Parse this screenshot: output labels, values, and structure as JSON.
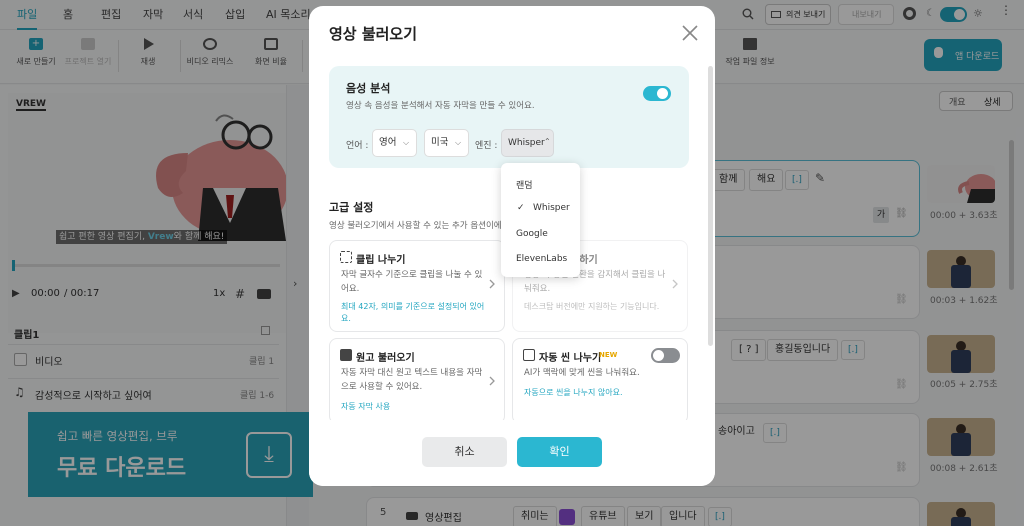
{
  "menu": {
    "tabs": [
      "파일",
      "홈",
      "편집",
      "자막",
      "서식",
      "삽입",
      "AI 목소리"
    ],
    "feedback": "의견 보내기",
    "export": "내보내기"
  },
  "toolbar": {
    "new": "새로 만들기",
    "open": "프로젝트 열기",
    "play": "재생",
    "remix": "비디오 리믹스",
    "ratio": "화면 비율",
    "info": "작업 파일 정보",
    "app_download": "앱 다운로드"
  },
  "player": {
    "caption_pre": "쉽고 편한 영상 편집기,",
    "caption_brand": "Vrew",
    "caption_post": "와 함께 해요!",
    "current": "00:00",
    "total": "/ 00:17",
    "speed": "1x"
  },
  "clip_panel": {
    "title": "클립1",
    "video_label": "비디오",
    "video_meta": "클립 1",
    "music_label": "감성적으로 시작하고 싶어여",
    "music_meta": "클립 1-6"
  },
  "banner": {
    "line1": "쉽고 빠른 영상편집, 브루",
    "line2": "무료 다운로드"
  },
  "view_toggle": {
    "summary": "개요",
    "detail": "상세"
  },
  "clips": [
    {
      "words": [
        "함께",
        "해요",
        "[.]"
      ],
      "thumb_cap": "00:00 + 3.63초",
      "action": "가"
    },
    {
      "words": [],
      "thumb_cap": "00:03 + 1.62초"
    },
    {
      "words": [
        "[ ? ]",
        "홍길동입니다",
        "[.]"
      ],
      "thumb_cap": "00:05 + 2.75초"
    },
    {
      "words": [
        "송아이고",
        "[.]"
      ],
      "thumb_cap": "00:08 + 2.61초"
    },
    {
      "number": "5",
      "label": "영상편집",
      "words": [
        "취미는",
        "유튜브",
        "보기",
        "입니다",
        "[.]"
      ]
    }
  ],
  "modal": {
    "title": "영상 불러오기",
    "analysis": {
      "title": "음성 분석",
      "desc": "영상 속 음성을 분석해서 자동 자막을 만들 수 있어요.",
      "lang_label": "언어 :",
      "lang_value": "영어",
      "region_value": "미국",
      "engine_label": "엔진 :",
      "engine_value": "Whisper",
      "enabled": true
    },
    "engine_options": [
      "랜덤",
      "Whisper",
      "Google",
      "ElevenLabs"
    ],
    "engine_selected": "Whisper",
    "advanced": {
      "title": "고급 설정",
      "desc": "영상 불러오기에서 사용할 수 있는 추가 옵션이에요."
    },
    "cards": [
      {
        "title": "클립 나누기",
        "desc": "자막 글자수 기준으로 클립을 나눌 수 있어요.",
        "link": "최대 42자, 의미를 기준으로 설정되어 있어요."
      },
      {
        "title": "장면 감지하기",
        "desc": "영상 속 장면 전환을 감지해서 클립을 나눠줘요.",
        "link": "데스크탑 버전에만 지원하는 기능입니다."
      },
      {
        "title": "원고 불러오기",
        "desc": "자동 자막 대신 원고 텍스트 내용을 자막으로 사용할 수 있어요.",
        "link": "자동 자막 사용"
      },
      {
        "title": "자동 씬 나누기",
        "badge": "NEW",
        "desc": "AI가 맥락에 맞게 씬을 나눠줘요.",
        "link": "자동으로 씬을 나누지 않아요.",
        "enabled": false
      }
    ],
    "cancel": "취소",
    "confirm": "확인"
  },
  "colors": {
    "accent": "#23a6c0",
    "banner": "#2aa3ba",
    "confirm": "#2bb7d1"
  }
}
